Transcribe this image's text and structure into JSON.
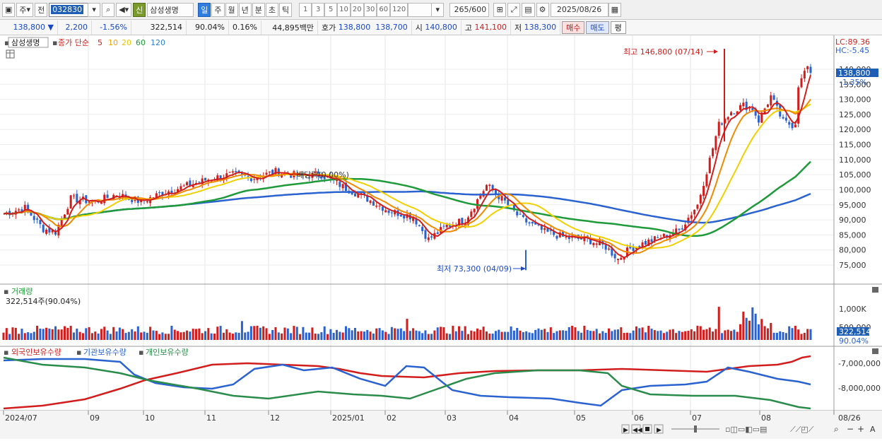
{
  "toolbar": {
    "market": "주",
    "prev_label": "전",
    "code": "032830",
    "search_icon": "search-icon",
    "sin_badge": "신",
    "name": "삼성생명",
    "periods": [
      "일",
      "주",
      "월",
      "년",
      "분",
      "초",
      "틱"
    ],
    "selected_period": "일",
    "intervals": [
      "1",
      "3",
      "5",
      "10",
      "20",
      "30",
      "60",
      "120"
    ],
    "range": "265",
    "range_total": "/600",
    "date": "2025/08/26"
  },
  "quote": {
    "price": "138,800",
    "arrow": "▼",
    "change": "2,200",
    "change_pct": "-1.56%",
    "volume": "322,514",
    "vol_ratio": "90.04%",
    "turnover": "0.16%",
    "amount": "44,895백만",
    "hoga_label": "호가",
    "ask": "138,800",
    "bid": "138,700",
    "open_label": "시",
    "open": "140,800",
    "high_label": "고",
    "high": "141,100",
    "low_label": "저",
    "low": "138,300",
    "buy_btn": "매수",
    "sell_btn": "매도",
    "avg_btn": "평"
  },
  "price_panel": {
    "title": "삼성생명",
    "ma_label": "종가 단순",
    "ma_list": [
      {
        "n": "5",
        "color": "#d21d1d"
      },
      {
        "n": "10",
        "color": "#f0a000"
      },
      {
        "n": "20",
        "color": "#e8c800"
      },
      {
        "n": "60",
        "color": "#1f9a3a"
      },
      {
        "n": "120",
        "color": "#2a7fd0"
      }
    ],
    "lc": "LC:89.36",
    "hc": "HC:-5.45",
    "last_price": "138,800",
    "last_pct": "-1.35%",
    "high_note": "최고 146,800 (07/14)",
    "low_note": "최저 73,300 (04/09)",
    "div_note": "배당락(0.00%)",
    "y_ticks": [
      "140,000",
      "135,000",
      "130,000",
      "125,000",
      "120,000",
      "115,000",
      "110,000",
      "105,000",
      "100,000",
      "95,000",
      "90,000",
      "85,000",
      "80,000",
      "75,000"
    ]
  },
  "volume_panel": {
    "title": "거래량",
    "value": "322,514주(90.04%)",
    "y_ticks": [
      "1,000K",
      "500,000"
    ],
    "last": "322,514",
    "last_pct": "90.04%"
  },
  "holding_panel": {
    "legend": [
      {
        "label": "외국인보유수량",
        "color": "#d21d1d"
      },
      {
        "label": "기관보유수량",
        "color": "#2a62d0"
      },
      {
        "label": "개인보유수량",
        "color": "#2a8c4a"
      }
    ],
    "y_ticks": [
      "-7,000,000",
      "-8,000,000"
    ]
  },
  "x_axis": [
    "2024/07",
    "09",
    "10",
    "11",
    "12",
    "2025/01",
    "02",
    "03",
    "04",
    "05",
    "06",
    "07",
    "08",
    "08/26"
  ],
  "colors": {
    "up": "#d21d1d",
    "down": "#2a62d0",
    "ma5": "#d21d1d",
    "ma10": "#f08a00",
    "ma20": "#f0d000",
    "ma60": "#1f9a3a",
    "ma120": "#2a62d0"
  }
}
